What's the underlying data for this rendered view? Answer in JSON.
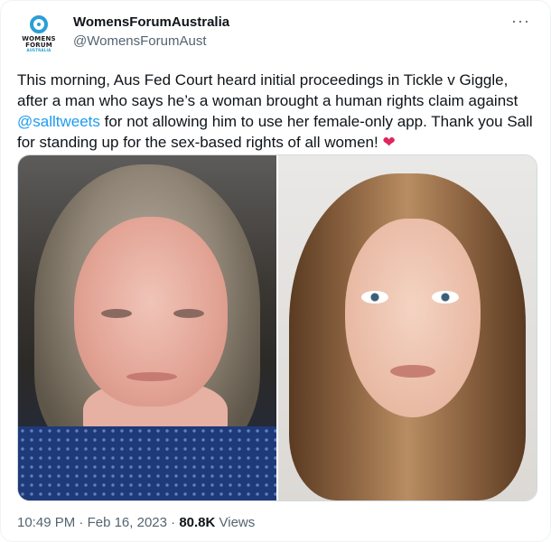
{
  "author": {
    "display_name": "WomensForumAustralia",
    "handle": "@WomensForumAust",
    "avatar_text_line1": "WOMENS",
    "avatar_text_line2": "FORUM",
    "avatar_text_sub": "AUSTRALIA"
  },
  "more_label": "···",
  "tweet": {
    "text_part1": "This morning, Aus Fed Court heard initial proceedings in Tickle v Giggle, after a man who says he’s a woman brought a human rights claim against ",
    "mention": "@salltweets",
    "text_part2": " for not allowing him to use her female-only app. Thank you Sall for standing up for the sex-based rights of all women! ",
    "emoji": "❤"
  },
  "meta": {
    "time": "10:49 PM",
    "separator": " · ",
    "date": "Feb 16, 2023",
    "views_count": "80.8K",
    "views_label": " Views"
  },
  "colors": {
    "link": "#1d9bf0",
    "brand_blue": "#2a9fd6",
    "text": "#0f1419",
    "secondary": "#536471"
  }
}
